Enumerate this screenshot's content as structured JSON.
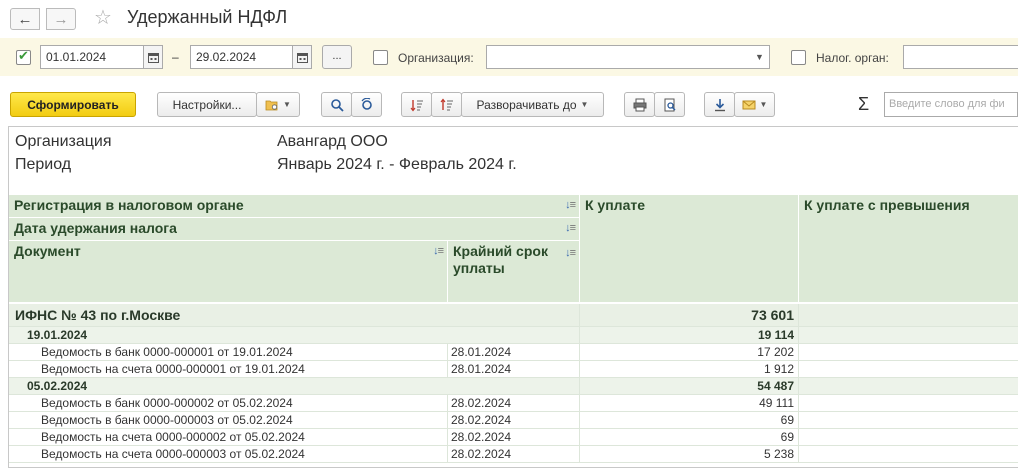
{
  "window": {
    "title": "Удержанный НДФЛ"
  },
  "filters": {
    "period_enabled": true,
    "date_from": "01.01.2024",
    "date_sep": "–",
    "date_to": "29.02.2024",
    "more_label": "...",
    "org_label": "Организация:",
    "org_value": "",
    "tax_label": "Налог. орган:",
    "tax_value": ""
  },
  "toolbar": {
    "generate_label": "Сформировать",
    "settings_label": "Настройки...",
    "expand_label": "Разворачивать до",
    "sigma": "Σ",
    "search_placeholder": "Введите слово для фи"
  },
  "report": {
    "meta": [
      {
        "key": "Организация",
        "value": "Авангард ООО"
      },
      {
        "key": "Период",
        "value": "Январь 2024 г. - Февраль 2024 г."
      }
    ],
    "headers": {
      "registration": "Регистрация в налоговом органе",
      "date": "Дата удержания налога",
      "document": "Документ",
      "deadline": "Крайний срок уплаты",
      "to_pay": "К уплате",
      "to_pay_excess": "К уплате с превышения"
    },
    "rows": [
      {
        "level": 1,
        "label": "ИФНС № 43 по г.Москве",
        "deadline": "",
        "amount": "73 601"
      },
      {
        "level": 2,
        "label": "19.01.2024",
        "deadline": "",
        "amount": "19 114"
      },
      {
        "level": 3,
        "label": "Ведомость в банк 0000-000001 от 19.01.2024",
        "deadline": "28.01.2024",
        "amount": "17 202"
      },
      {
        "level": 3,
        "label": "Ведомость на счета 0000-000001 от 19.01.2024",
        "deadline": "28.01.2024",
        "amount": "1 912"
      },
      {
        "level": 2,
        "label": "05.02.2024",
        "deadline": "",
        "amount": "54 487"
      },
      {
        "level": 3,
        "label": "Ведомость в банк 0000-000002 от 05.02.2024",
        "deadline": "28.02.2024",
        "amount": "49 111"
      },
      {
        "level": 3,
        "label": "Ведомость в банк 0000-000003 от 05.02.2024",
        "deadline": "28.02.2024",
        "amount": "69"
      },
      {
        "level": 3,
        "label": "Ведомость на счета 0000-000002 от 05.02.2024",
        "deadline": "28.02.2024",
        "amount": "69"
      },
      {
        "level": 3,
        "label": "Ведомость на счета 0000-000003 от 05.02.2024",
        "deadline": "28.02.2024",
        "amount": "5 238"
      }
    ]
  }
}
